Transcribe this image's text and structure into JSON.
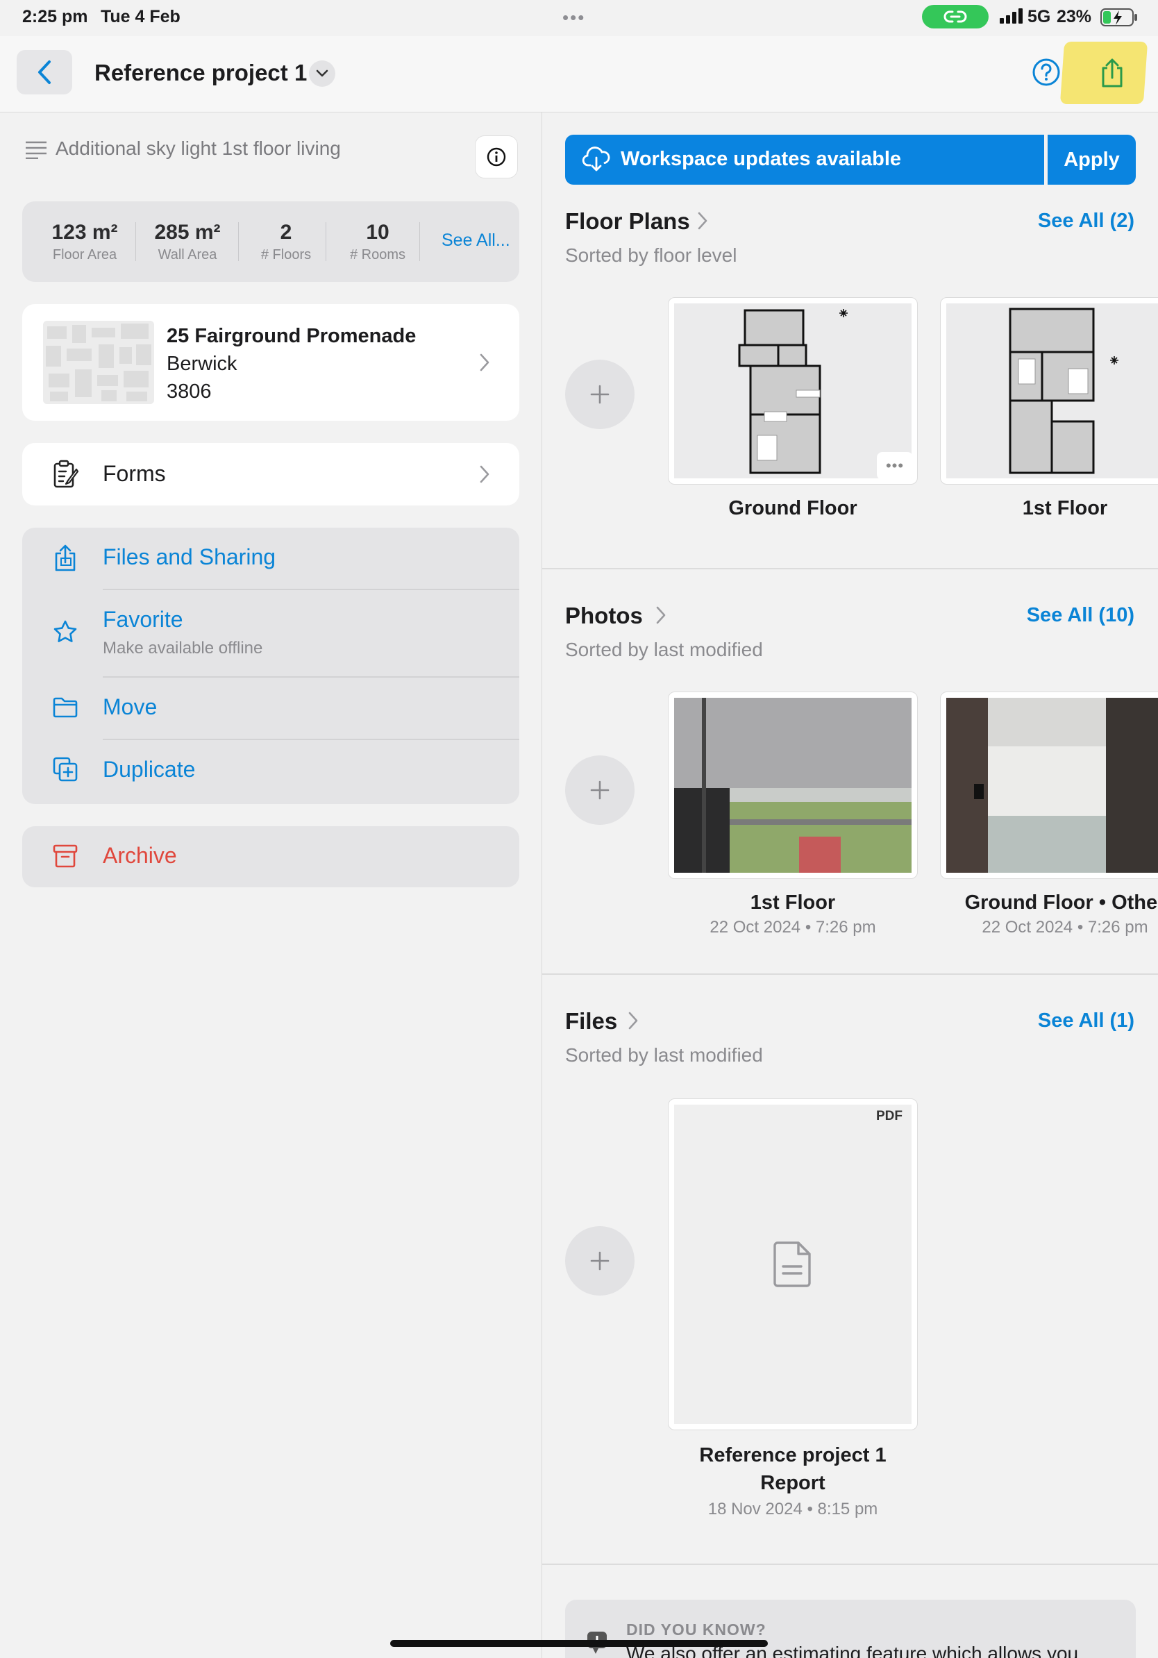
{
  "status_bar": {
    "time": "2:25 pm",
    "date": "Tue 4 Feb",
    "network": "5G",
    "battery": "23%"
  },
  "navbar": {
    "title": "Reference project 1"
  },
  "project": {
    "description": "Additional sky light 1st floor living",
    "stats": [
      {
        "value": "123 m²",
        "label": "Floor Area"
      },
      {
        "value": "285 m²",
        "label": "Wall Area"
      },
      {
        "value": "2",
        "label": "# Floors"
      },
      {
        "value": "10",
        "label": "# Rooms"
      }
    ],
    "stats_see_all": "See All...",
    "address": {
      "street": "25 Fairground Promenade",
      "suburb": "Berwick",
      "postcode": "3806"
    },
    "forms_label": "Forms",
    "actions": {
      "files_sharing": "Files and Sharing",
      "favorite": "Favorite",
      "favorite_sub": "Make available offline",
      "move": "Move",
      "duplicate": "Duplicate",
      "archive": "Archive"
    }
  },
  "workspace": {
    "updates_label": "Workspace updates available",
    "apply_label": "Apply"
  },
  "floor_plans": {
    "title": "Floor Plans",
    "subtitle": "Sorted by floor level",
    "see_all": "See All (2)",
    "items": [
      {
        "caption": "Ground Floor"
      },
      {
        "caption": "1st Floor"
      }
    ]
  },
  "photos": {
    "title": "Photos",
    "subtitle": "Sorted by last modified",
    "see_all": "See All (10)",
    "items": [
      {
        "caption": "1st Floor",
        "date": "22 Oct 2024 • 7:26 pm"
      },
      {
        "caption": "Ground Floor • Other",
        "date": "22 Oct 2024 • 7:26 pm"
      }
    ]
  },
  "files": {
    "title": "Files",
    "subtitle": "Sorted by last modified",
    "see_all": "See All (1)",
    "items": [
      {
        "badge": "PDF",
        "caption_line1": "Reference project 1",
        "caption_line2": "Report",
        "date": "18 Nov 2024 • 8:15 pm"
      }
    ]
  },
  "tip": {
    "title": "DID YOU KNOW?",
    "text": "We also offer an estimating feature which allows you"
  },
  "colors": {
    "accent": "#0a84d6",
    "destructive": "#e0473c",
    "link_indicator": "#34c759",
    "highlight": "#f5e25a"
  },
  "icons": [
    "back-chevron-icon",
    "dropdown-chevron-icon",
    "help-icon",
    "share-icon",
    "description-lines-icon",
    "info-icon",
    "chevron-right-icon",
    "forms-icon",
    "share-icon",
    "star-icon",
    "folder-icon",
    "duplicate-icon",
    "archive-icon",
    "cloud-download-icon",
    "plus-icon",
    "document-icon",
    "lightbulb-icon"
  ]
}
